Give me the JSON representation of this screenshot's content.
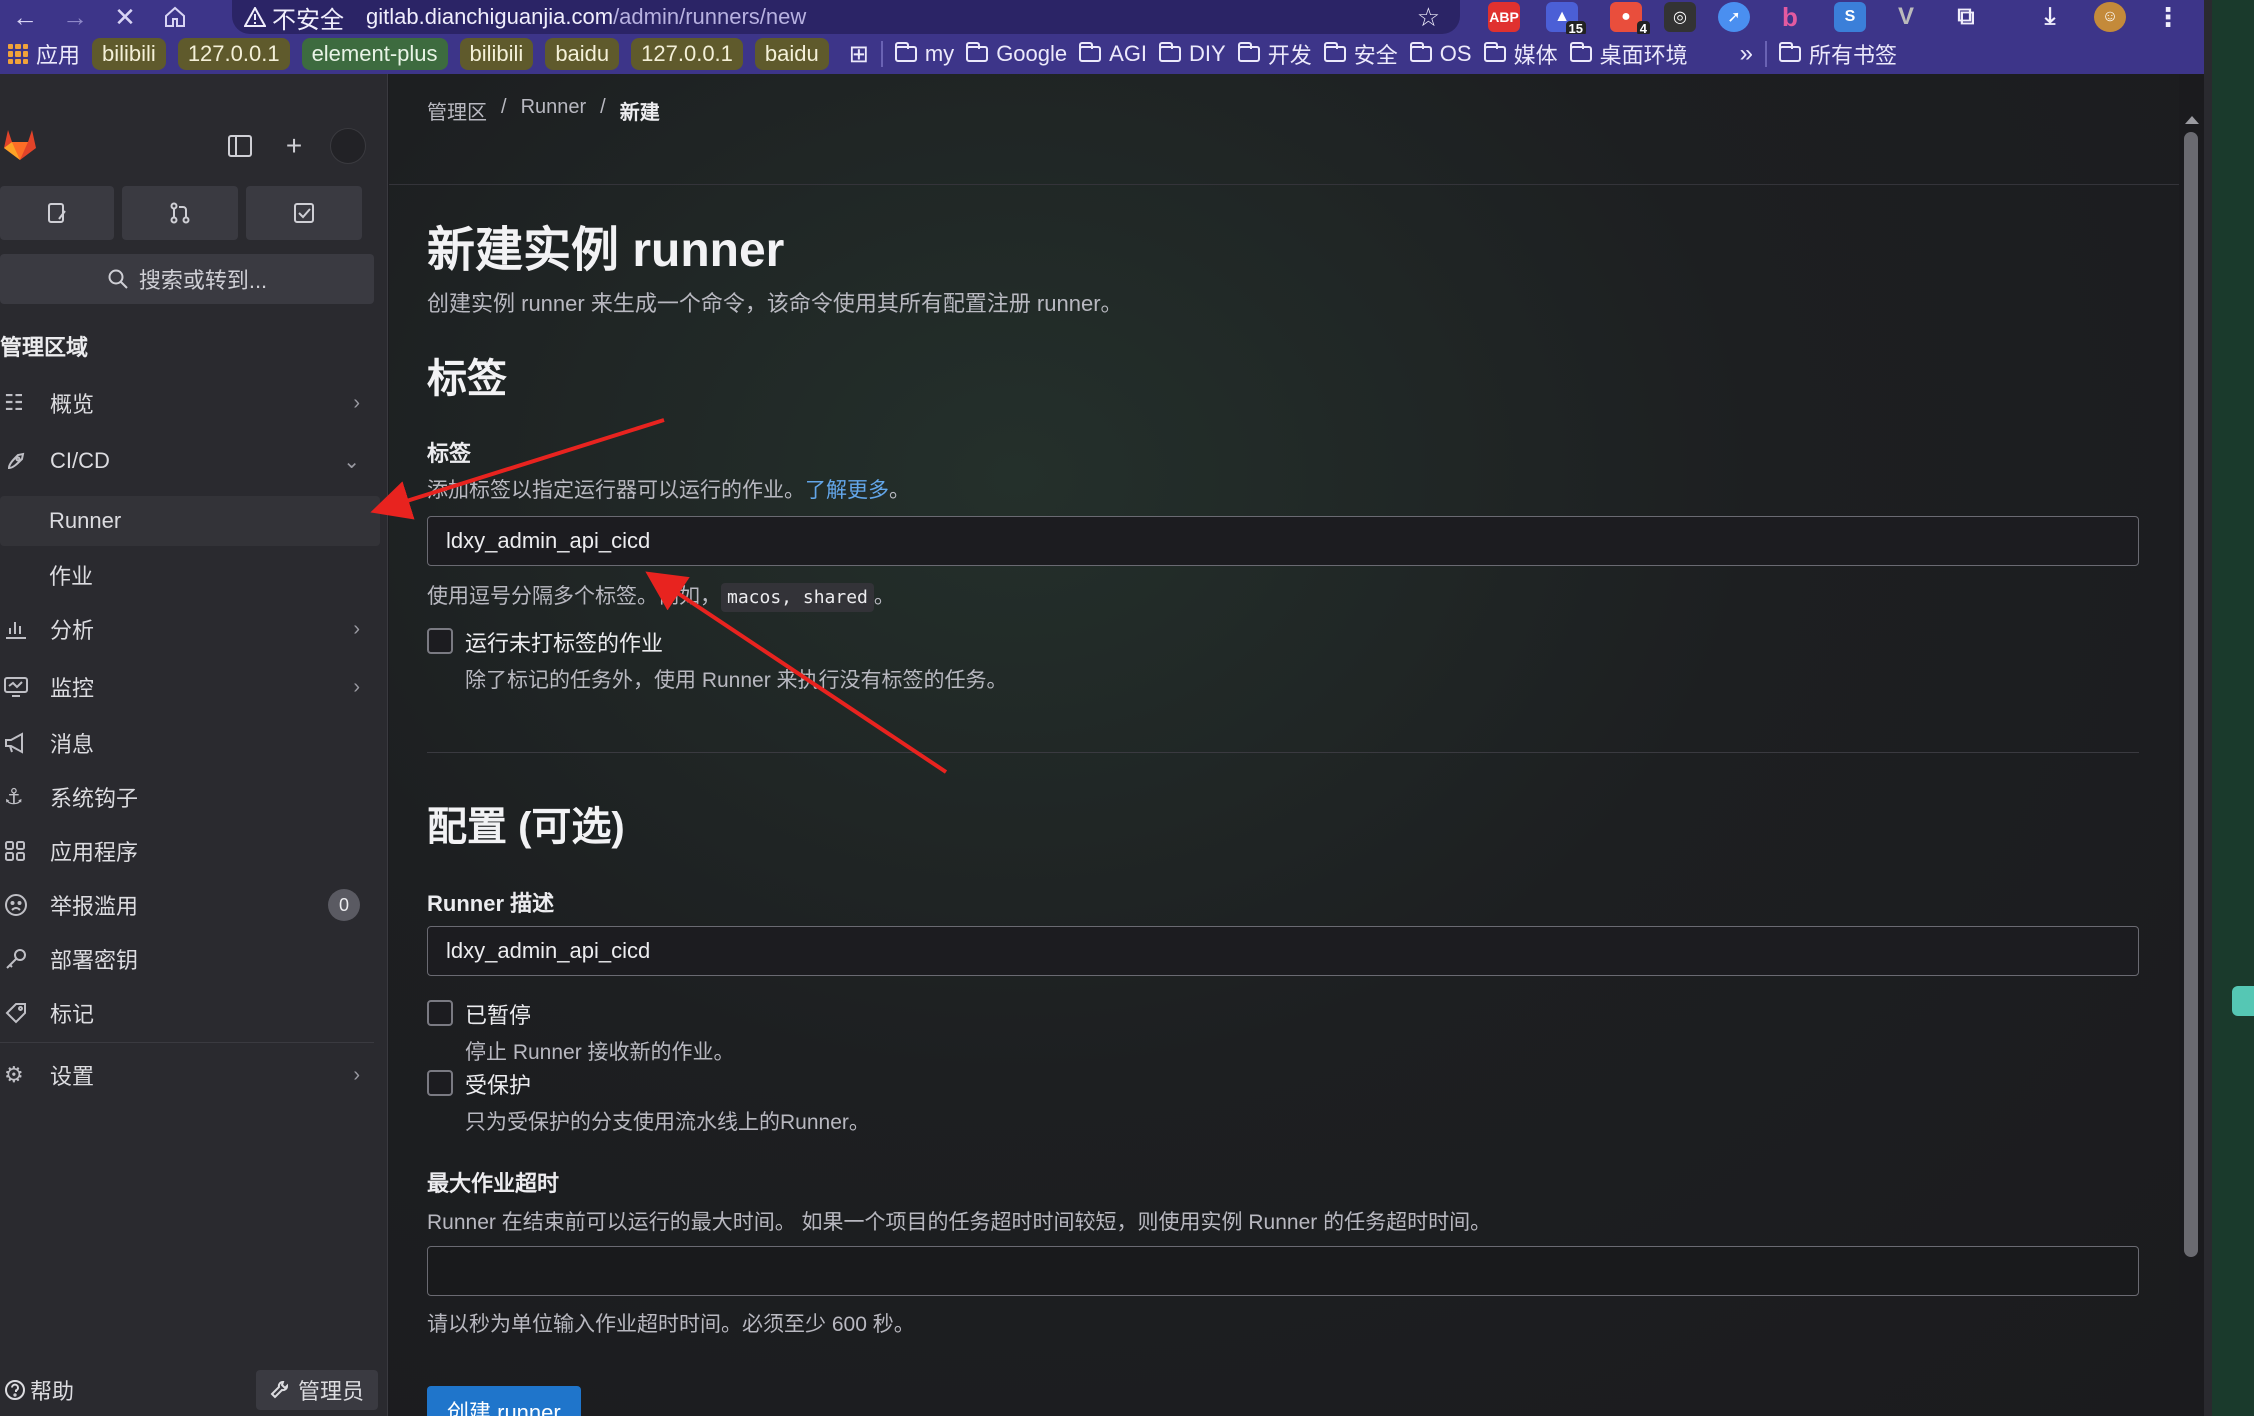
{
  "browser": {
    "address": {
      "warning": "不安全",
      "host": "gitlab.dianchiguanjia.com",
      "path": "/admin/runners/new"
    },
    "extensions": [
      {
        "name": "adblock-plus",
        "label": "ABP",
        "color": "#e0312f"
      },
      {
        "name": "hat-extension",
        "label": "",
        "badge": "15",
        "color": "#4b5fd6"
      },
      {
        "name": "dots-extension",
        "label": "",
        "badge": "4",
        "color": "#e94e3c"
      },
      {
        "name": "glasses-extension",
        "label": "",
        "color": "#333333"
      },
      {
        "name": "compass-extension",
        "label": "",
        "color": "#4a8ff0"
      },
      {
        "name": "bing-extension",
        "label": "b",
        "color": "#d14a8b"
      },
      {
        "name": "s-extension",
        "label": "S",
        "color": "#3b7fd9"
      },
      {
        "name": "vue-extension",
        "label": "V",
        "color": "#888888"
      }
    ],
    "bookmarks": {
      "apps": "应用",
      "chips": [
        {
          "label": "bilibili",
          "style": "olive"
        },
        {
          "label": "127.0.0.1",
          "style": "olive"
        },
        {
          "label": "element-plus",
          "style": "green"
        },
        {
          "label": "bilibili",
          "style": "olive"
        },
        {
          "label": "baidu",
          "style": "olive"
        },
        {
          "label": "127.0.0.1",
          "style": "olive"
        },
        {
          "label": "baidu",
          "style": "olive"
        }
      ],
      "folders": [
        "my",
        "Google",
        "AGI",
        "DIY",
        "开发",
        "安全",
        "OS",
        "媒体",
        "桌面环境"
      ],
      "more": "»",
      "all": "所有书签"
    }
  },
  "sidebar": {
    "search": "搜索或转到...",
    "section": "管理区域",
    "items": [
      {
        "label": "概览",
        "icon": "overview-icon",
        "chevron": "›"
      },
      {
        "label": "CI/CD",
        "icon": "rocket-icon",
        "chevron": "⌄"
      },
      {
        "label": "Runner",
        "icon": "",
        "chevron": ""
      },
      {
        "label": "作业",
        "icon": "",
        "chevron": ""
      },
      {
        "label": "分析",
        "icon": "chart-icon",
        "chevron": "›"
      },
      {
        "label": "监控",
        "icon": "monitor-icon",
        "chevron": "›"
      },
      {
        "label": "消息",
        "icon": "megaphone-icon",
        "chevron": ""
      },
      {
        "label": "系统钩子",
        "icon": "anchor-icon",
        "chevron": ""
      },
      {
        "label": "应用程序",
        "icon": "apps-icon",
        "chevron": ""
      },
      {
        "label": "举报滥用",
        "icon": "abuse-icon",
        "chevron": "",
        "count": "0"
      },
      {
        "label": "部署密钥",
        "icon": "key-icon",
        "chevron": ""
      },
      {
        "label": "标记",
        "icon": "label-icon",
        "chevron": ""
      },
      {
        "label": "设置",
        "icon": "gear-icon",
        "chevron": "›"
      }
    ],
    "help": "帮助",
    "admin": "管理员"
  },
  "main": {
    "breadcrumb": [
      "管理区",
      "Runner",
      "新建"
    ],
    "title": "新建实例 runner",
    "lead": "创建实例 runner 来生成一个命令，该命令使用其所有配置注册 runner。",
    "tags_heading": "标签",
    "tags_label": "标签",
    "tags_help": "添加标签以指定运行器可以运行的作业。",
    "tags_link": "了解更多",
    "tags_help_end": "。",
    "tags_value": "ldxy_admin_api_cicd",
    "tags_hint_pre": "使用逗号分隔多个标签。例如，",
    "tags_hint_code": "macos, shared",
    "tags_hint_post": "。",
    "untagged_title": "运行未打标签的作业",
    "untagged_desc": "除了标记的任务外，使用 Runner 来执行没有标签的任务。",
    "config_heading": "配置 (可选)",
    "desc_label": "Runner 描述",
    "desc_value": "ldxy_admin_api_cicd",
    "paused_title": "已暂停",
    "paused_desc": "停止 Runner 接收新的作业。",
    "protected_title": "受保护",
    "protected_desc": "只为受保护的分支使用流水线上的Runner。",
    "timeout_label": "最大作业超时",
    "timeout_help": "Runner 在结束前可以运行的最大时间。 如果一个项目的任务超时时间较短，则使用实例 Runner 的任务超时时间。",
    "timeout_value": "",
    "timeout_hint": "请以秒为单位输入作业超时时间。必须至少 600 秒。",
    "submit": "创建 runner"
  },
  "colors": {
    "accent": "#1f75cb",
    "link": "#63a6e9",
    "annotation": "#e8231f",
    "chrome": "#3d3589"
  }
}
